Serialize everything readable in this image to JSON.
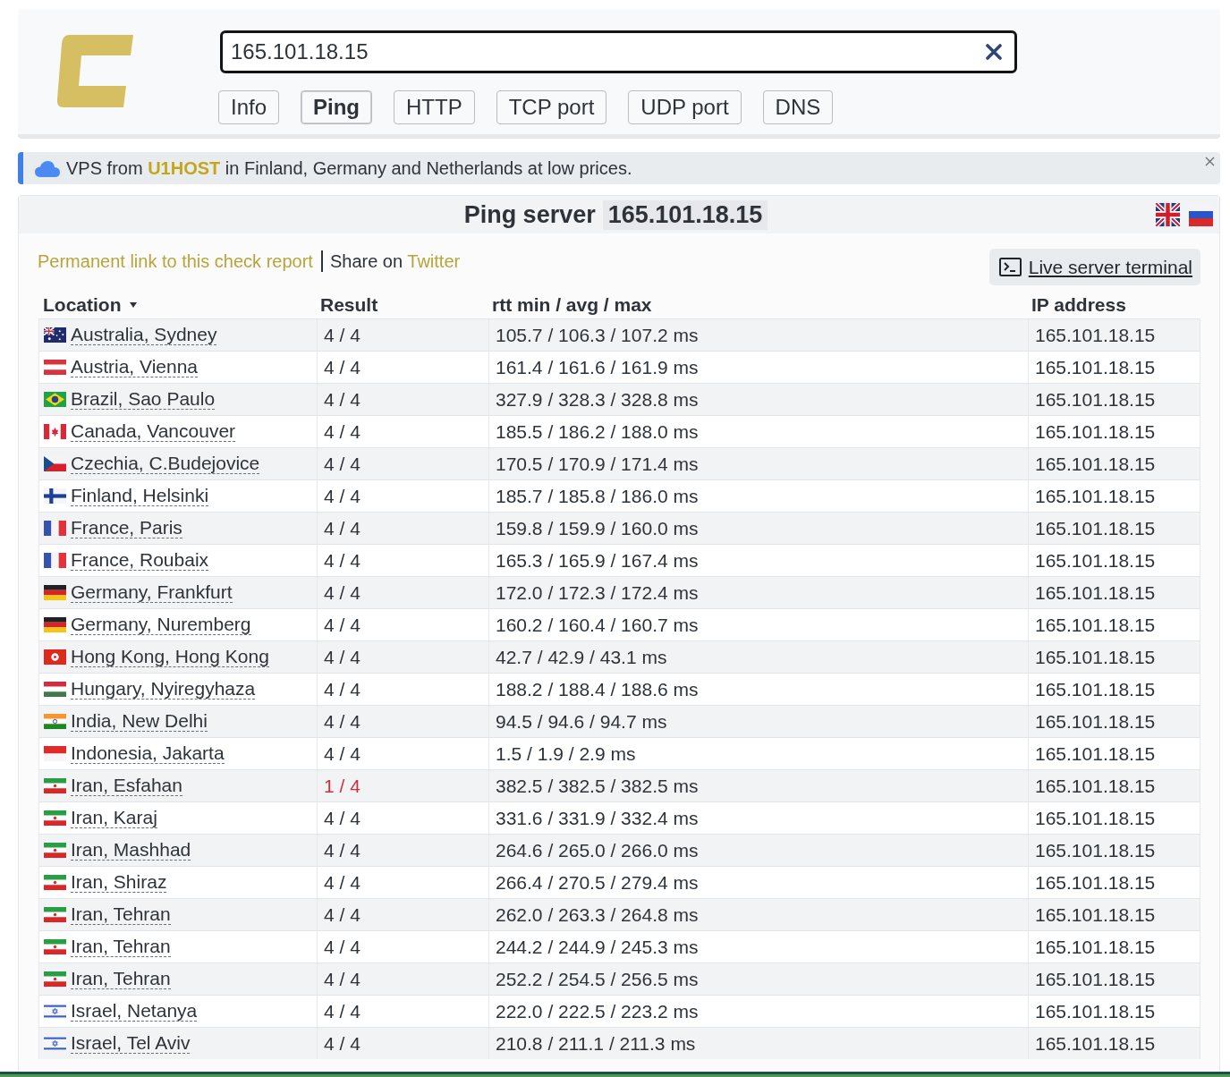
{
  "header": {
    "search": {
      "value": "165.101.18.15"
    },
    "tabs": [
      {
        "label": "Info",
        "selected": false
      },
      {
        "label": "Ping",
        "selected": true
      },
      {
        "label": "HTTP",
        "selected": false
      },
      {
        "label": "TCP port",
        "selected": false
      },
      {
        "label": "UDP port",
        "selected": false
      },
      {
        "label": "DNS",
        "selected": false
      }
    ]
  },
  "notice": {
    "text_before": "VPS from",
    "link": "U1HOST",
    "text_after": "in Finland, Germany and Netherlands at low prices."
  },
  "title": {
    "text": "Ping server",
    "host": "165.101.18.15"
  },
  "links": {
    "permalink": "Permanent link to this check report",
    "share_text": "Share on",
    "share_link": "Twitter"
  },
  "terminal_button": "Live server terminal",
  "table": {
    "columns": [
      {
        "label": "Location",
        "sorted": true
      },
      {
        "label": "Result",
        "sorted": false
      },
      {
        "label": "rtt min / avg / max",
        "sorted": false
      },
      {
        "label": "IP address",
        "sorted": false
      }
    ],
    "rows": [
      {
        "kind": "australia",
        "location": "Australia, Sydney",
        "result": "4 / 4",
        "packet_loss": false,
        "rtt": "105.7 / 106.3 / 107.2 ms",
        "ip": "165.101.18.15"
      },
      {
        "kind": "austria",
        "location": "Austria, Vienna",
        "result": "4 / 4",
        "packet_loss": false,
        "rtt": "161.4 / 161.6 / 161.9 ms",
        "ip": "165.101.18.15"
      },
      {
        "kind": "brazil",
        "location": "Brazil, Sao Paulo",
        "result": "4 / 4",
        "packet_loss": false,
        "rtt": "327.9 / 328.3 / 328.8 ms",
        "ip": "165.101.18.15"
      },
      {
        "kind": "canada",
        "location": "Canada, Vancouver",
        "result": "4 / 4",
        "packet_loss": false,
        "rtt": "185.5 / 186.2 / 188.0 ms",
        "ip": "165.101.18.15"
      },
      {
        "kind": "czechia",
        "location": "Czechia, C.Budejovice",
        "result": "4 / 4",
        "packet_loss": false,
        "rtt": "170.5 / 170.9 / 171.4 ms",
        "ip": "165.101.18.15"
      },
      {
        "kind": "finland",
        "location": "Finland, Helsinki",
        "result": "4 / 4",
        "packet_loss": false,
        "rtt": "185.7 / 185.8 / 186.0 ms",
        "ip": "165.101.18.15"
      },
      {
        "kind": "france",
        "location": "France, Paris",
        "result": "4 / 4",
        "packet_loss": false,
        "rtt": "159.8 / 159.9 / 160.0 ms",
        "ip": "165.101.18.15"
      },
      {
        "kind": "france",
        "location": "France, Roubaix",
        "result": "4 / 4",
        "packet_loss": false,
        "rtt": "165.3 / 165.9 / 167.4 ms",
        "ip": "165.101.18.15"
      },
      {
        "kind": "germany",
        "location": "Germany, Frankfurt",
        "result": "4 / 4",
        "packet_loss": false,
        "rtt": "172.0 / 172.3 / 172.4 ms",
        "ip": "165.101.18.15"
      },
      {
        "kind": "germany",
        "location": "Germany, Nuremberg",
        "result": "4 / 4",
        "packet_loss": false,
        "rtt": "160.2 / 160.4 / 160.7 ms",
        "ip": "165.101.18.15"
      },
      {
        "kind": "hongkong",
        "location": "Hong Kong, Hong Kong",
        "result": "4 / 4",
        "packet_loss": false,
        "rtt": "42.7 / 42.9 / 43.1 ms",
        "ip": "165.101.18.15"
      },
      {
        "kind": "hungary",
        "location": "Hungary, Nyiregyhaza",
        "result": "4 / 4",
        "packet_loss": false,
        "rtt": "188.2 / 188.4 / 188.6 ms",
        "ip": "165.101.18.15"
      },
      {
        "kind": "india",
        "location": "India, New Delhi",
        "result": "4 / 4",
        "packet_loss": false,
        "rtt": "94.5 / 94.6 / 94.7 ms",
        "ip": "165.101.18.15"
      },
      {
        "kind": "indonesia",
        "location": "Indonesia, Jakarta",
        "result": "4 / 4",
        "packet_loss": false,
        "rtt": "1.5 / 1.9 / 2.9 ms",
        "ip": "165.101.18.15"
      },
      {
        "kind": "iran",
        "location": "Iran, Esfahan",
        "result": "1 / 4",
        "packet_loss": true,
        "rtt": "382.5 / 382.5 / 382.5 ms",
        "ip": "165.101.18.15"
      },
      {
        "kind": "iran",
        "location": "Iran, Karaj",
        "result": "4 / 4",
        "packet_loss": false,
        "rtt": "331.6 / 331.9 / 332.4 ms",
        "ip": "165.101.18.15"
      },
      {
        "kind": "iran",
        "location": "Iran, Mashhad",
        "result": "4 / 4",
        "packet_loss": false,
        "rtt": "264.6 / 265.0 / 266.0 ms",
        "ip": "165.101.18.15"
      },
      {
        "kind": "iran",
        "location": "Iran, Shiraz",
        "result": "4 / 4",
        "packet_loss": false,
        "rtt": "266.4 / 270.5 / 279.4 ms",
        "ip": "165.101.18.15"
      },
      {
        "kind": "iran",
        "location": "Iran, Tehran",
        "result": "4 / 4",
        "packet_loss": false,
        "rtt": "262.0 / 263.3 / 264.8 ms",
        "ip": "165.101.18.15"
      },
      {
        "kind": "iran",
        "location": "Iran, Tehran",
        "result": "4 / 4",
        "packet_loss": false,
        "rtt": "244.2 / 244.9 / 245.3 ms",
        "ip": "165.101.18.15"
      },
      {
        "kind": "iran",
        "location": "Iran, Tehran",
        "result": "4 / 4",
        "packet_loss": false,
        "rtt": "252.2 / 254.5 / 256.5 ms",
        "ip": "165.101.18.15"
      },
      {
        "kind": "israel",
        "location": "Israel, Netanya",
        "result": "4 / 4",
        "packet_loss": false,
        "rtt": "222.0 / 222.5 / 223.2 ms",
        "ip": "165.101.18.15"
      },
      {
        "kind": "israel",
        "location": "Israel, Tel Aviv",
        "result": "4 / 4",
        "packet_loss": false,
        "rtt": "210.8 / 211.1 / 211.3 ms",
        "ip": "165.101.18.15"
      }
    ]
  }
}
